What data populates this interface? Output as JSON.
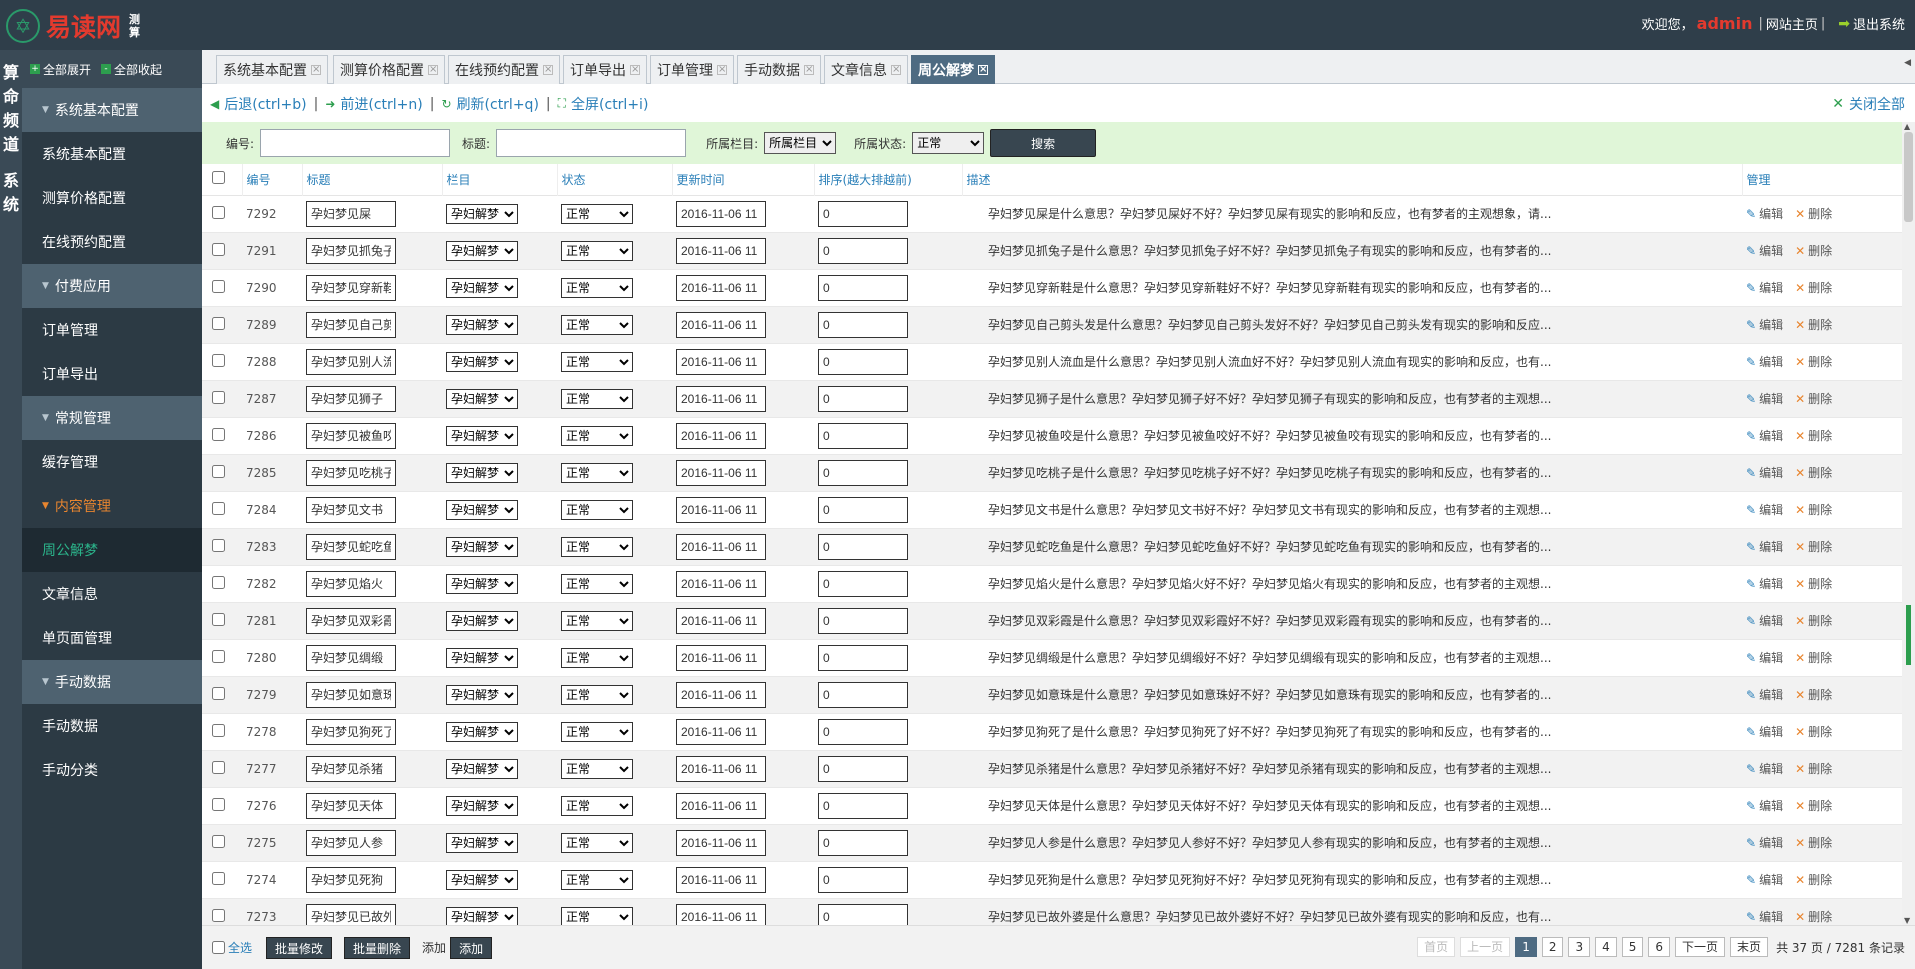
{
  "header": {
    "logo_mark": "✡",
    "logo_text": "易读网",
    "logo_sub": "测算",
    "welcome": "欢迎您，",
    "user": "admin",
    "home_link": "网站主页",
    "logout": "退出系统"
  },
  "vstrip": [
    "算",
    "命",
    "频",
    "道",
    "",
    "系",
    "统"
  ],
  "sidebar": {
    "expand_all": "全部展开",
    "collapse_all": "全部收起",
    "sections": [
      {
        "label": "系统基本配置",
        "items": [
          "系统基本配置",
          "测算价格配置",
          "在线预约配置"
        ]
      },
      {
        "label": "付费应用",
        "items": [
          "订单管理",
          "订单导出"
        ]
      },
      {
        "label": "常规管理",
        "items": [
          "缓存管理"
        ]
      },
      {
        "label": "内容管理",
        "items": [
          "周公解梦",
          "文章信息",
          "单页面管理"
        ]
      },
      {
        "label": "手动数据",
        "items": [
          "手动数据",
          "手动分类"
        ]
      }
    ]
  },
  "tabs": [
    "系统基本配置",
    "测算价格配置",
    "在线预约配置",
    "订单导出",
    "订单管理",
    "手动数据",
    "文章信息",
    "周公解梦"
  ],
  "navbar": {
    "back": "后退(ctrl+b)",
    "forward": "前进(ctrl+n)",
    "refresh": "刷新(ctrl+q)",
    "fullscreen": "全屏(ctrl+i)",
    "close_all": "关闭全部"
  },
  "filter": {
    "id_label": "编号:",
    "title_label": "标题:",
    "column_label": "所属栏目:",
    "column_value": "所属栏目",
    "status_label": "所属状态:",
    "status_value": "正常",
    "search_button": "搜索"
  },
  "table": {
    "headers": [
      "编号",
      "标题",
      "栏目",
      "状态",
      "更新时间",
      "排序(越大排越前)",
      "描述",
      "管理"
    ],
    "column_value": "孕妇解梦",
    "status_value": "正常",
    "date_value": "2016-11-06 11",
    "sort_value": "0",
    "edit_label": "编辑",
    "delete_label": "删除",
    "rows": [
      {
        "id": "7292",
        "title": "孕妇梦见屎",
        "desc": "孕妇梦见屎是什么意思？孕妇梦见屎好不好？孕妇梦见屎有现实的影响和反应，也有梦者的主观想象，请..."
      },
      {
        "id": "7291",
        "title": "孕妇梦见抓兔子",
        "desc": "孕妇梦见抓兔子是什么意思？孕妇梦见抓兔子好不好？孕妇梦见抓兔子有现实的影响和反应，也有梦者的..."
      },
      {
        "id": "7290",
        "title": "孕妇梦见穿新鞋",
        "desc": "孕妇梦见穿新鞋是什么意思？孕妇梦见穿新鞋好不好？孕妇梦见穿新鞋有现实的影响和反应，也有梦者的..."
      },
      {
        "id": "7289",
        "title": "孕妇梦见自己剪头发",
        "desc": "孕妇梦见自己剪头发是什么意思？孕妇梦见自己剪头发好不好？孕妇梦见自己剪头发有现实的影响和反应..."
      },
      {
        "id": "7288",
        "title": "孕妇梦见别人流血",
        "desc": "孕妇梦见别人流血是什么意思？孕妇梦见别人流血好不好？孕妇梦见别人流血有现实的影响和反应，也有..."
      },
      {
        "id": "7287",
        "title": "孕妇梦见狮子",
        "desc": "孕妇梦见狮子是什么意思？孕妇梦见狮子好不好？孕妇梦见狮子有现实的影响和反应，也有梦者的主观想..."
      },
      {
        "id": "7286",
        "title": "孕妇梦见被鱼咬",
        "desc": "孕妇梦见被鱼咬是什么意思？孕妇梦见被鱼咬好不好？孕妇梦见被鱼咬有现实的影响和反应，也有梦者的..."
      },
      {
        "id": "7285",
        "title": "孕妇梦见吃桃子",
        "desc": "孕妇梦见吃桃子是什么意思？孕妇梦见吃桃子好不好？孕妇梦见吃桃子有现实的影响和反应，也有梦者的..."
      },
      {
        "id": "7284",
        "title": "孕妇梦见文书",
        "desc": "孕妇梦见文书是什么意思？孕妇梦见文书好不好？孕妇梦见文书有现实的影响和反应，也有梦者的主观想..."
      },
      {
        "id": "7283",
        "title": "孕妇梦见蛇吃鱼",
        "desc": "孕妇梦见蛇吃鱼是什么意思？孕妇梦见蛇吃鱼好不好？孕妇梦见蛇吃鱼有现实的影响和反应，也有梦者的..."
      },
      {
        "id": "7282",
        "title": "孕妇梦见焰火",
        "desc": "孕妇梦见焰火是什么意思？孕妇梦见焰火好不好？孕妇梦见焰火有现实的影响和反应，也有梦者的主观想..."
      },
      {
        "id": "7281",
        "title": "孕妇梦见双彩霞",
        "desc": "孕妇梦见双彩霞是什么意思？孕妇梦见双彩霞好不好？孕妇梦见双彩霞有现实的影响和反应，也有梦者的..."
      },
      {
        "id": "7280",
        "title": "孕妇梦见绸缎",
        "desc": "孕妇梦见绸缎是什么意思？孕妇梦见绸缎好不好？孕妇梦见绸缎有现实的影响和反应，也有梦者的主观想..."
      },
      {
        "id": "7279",
        "title": "孕妇梦见如意珠",
        "desc": "孕妇梦见如意珠是什么意思？孕妇梦见如意珠好不好？孕妇梦见如意珠有现实的影响和反应，也有梦者的..."
      },
      {
        "id": "7278",
        "title": "孕妇梦见狗死了",
        "desc": "孕妇梦见狗死了是什么意思？孕妇梦见狗死了好不好？孕妇梦见狗死了有现实的影响和反应，也有梦者的..."
      },
      {
        "id": "7277",
        "title": "孕妇梦见杀猪",
        "desc": "孕妇梦见杀猪是什么意思？孕妇梦见杀猪好不好？孕妇梦见杀猪有现实的影响和反应，也有梦者的主观想..."
      },
      {
        "id": "7276",
        "title": "孕妇梦见天体",
        "desc": "孕妇梦见天体是什么意思？孕妇梦见天体好不好？孕妇梦见天体有现实的影响和反应，也有梦者的主观想..."
      },
      {
        "id": "7275",
        "title": "孕妇梦见人参",
        "desc": "孕妇梦见人参是什么意思？孕妇梦见人参好不好？孕妇梦见人参有现实的影响和反应，也有梦者的主观想..."
      },
      {
        "id": "7274",
        "title": "孕妇梦见死狗",
        "desc": "孕妇梦见死狗是什么意思？孕妇梦见死狗好不好？孕妇梦见死狗有现实的影响和反应，也有梦者的主观想..."
      },
      {
        "id": "7273",
        "title": "孕妇梦见已故外婆",
        "desc": "孕妇梦见已故外婆是什么意思？孕妇梦见已故外婆好不好？孕妇梦见已故外婆有现实的影响和反应，也有..."
      }
    ]
  },
  "bottom": {
    "select_all": "全选",
    "batch_edit": "批量修改",
    "batch_delete": "批量删除",
    "add_label": "添加",
    "add_button": "添加"
  },
  "pager": {
    "first": "首页",
    "prev": "上一页",
    "pages": [
      "1",
      "2",
      "3",
      "4",
      "5",
      "6"
    ],
    "current": "1",
    "next": "下一页",
    "last": "末页",
    "total": "共 37 页 / 7281 条记录"
  }
}
